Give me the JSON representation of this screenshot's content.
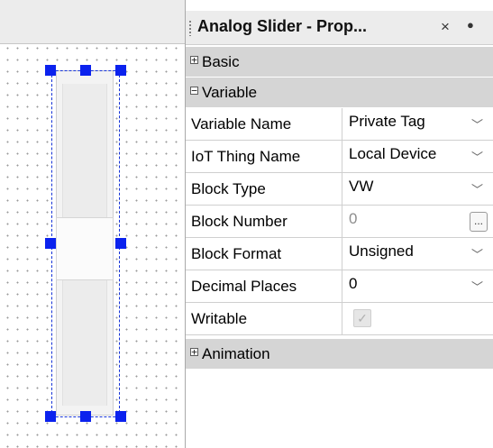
{
  "panel": {
    "title": "Analog Slider - Prop...",
    "close_glyph": "×",
    "pin_glyph": "●"
  },
  "categories": {
    "basic": {
      "label": "Basic",
      "expander": "+"
    },
    "variable": {
      "label": "Variable",
      "expander": "−"
    },
    "animation": {
      "label": "Animation",
      "expander": "+"
    }
  },
  "properties": [
    {
      "name": "Variable Name",
      "value": "Private Tag",
      "control": "dropdown"
    },
    {
      "name": "IoT Thing Name",
      "value": "Local Device",
      "control": "dropdown"
    },
    {
      "name": "Block Type",
      "value": "VW",
      "control": "dropdown"
    },
    {
      "name": "Block Number",
      "value": "0",
      "control": "ellipsis"
    },
    {
      "name": "Block Format",
      "value": "Unsigned",
      "control": "dropdown"
    },
    {
      "name": "Decimal Places",
      "value": "0",
      "control": "dropdown"
    },
    {
      "name": "Writable",
      "value": "",
      "control": "checkbox",
      "checked": true,
      "disabled": true
    }
  ],
  "icons": {
    "dropdown": "chevron-down-icon",
    "ellipsis": "ellipsis-icon",
    "checkbox": "check-icon"
  },
  "colors": {
    "selection": "#1533d8",
    "handle": "#0b22ee",
    "category_bg": "#d5d5d5",
    "titlebar_bg": "#ececec"
  }
}
